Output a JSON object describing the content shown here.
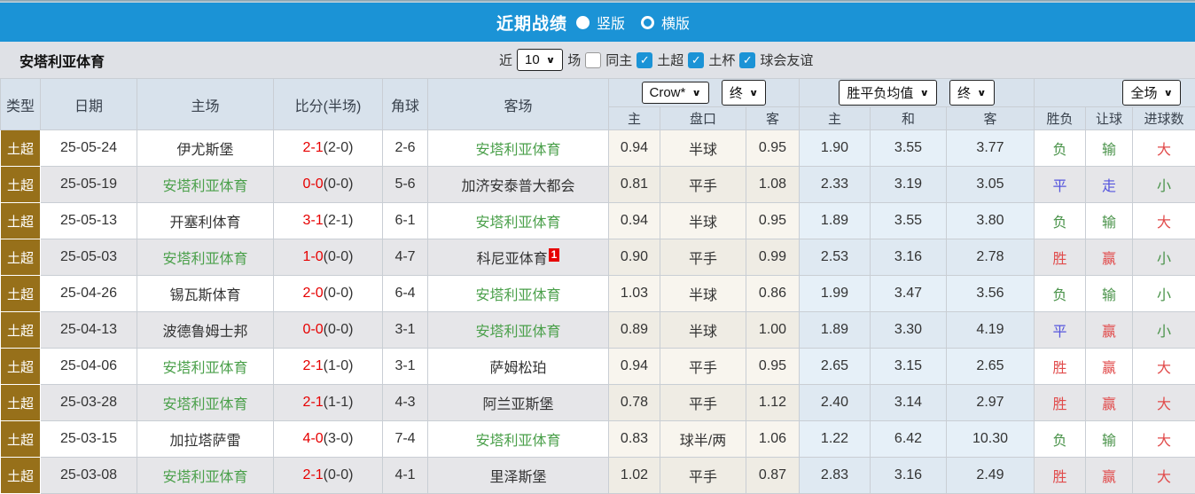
{
  "topbar": {
    "title": "近期战绩",
    "radio_vertical": "竖版",
    "radio_horizontal": "横版",
    "selected": "竖版"
  },
  "filterbar": {
    "team_name": "安塔利亚体育",
    "recent_label": "近",
    "recent_value": "10",
    "matches_label": "场",
    "checkboxes": [
      {
        "label": "同主",
        "checked": false
      },
      {
        "label": "土超",
        "checked": true
      },
      {
        "label": "土杯",
        "checked": true
      },
      {
        "label": "球会友谊",
        "checked": true
      }
    ]
  },
  "table": {
    "headers": {
      "type": "类型",
      "date": "日期",
      "home": "主场",
      "score": "比分(半场)",
      "corners": "角球",
      "away": "客场",
      "crow_select": "Crow*",
      "crow_final_select": "终",
      "avg_select": "胜平负均值",
      "avg_final_select": "终",
      "fulltime_select": "全场",
      "sub": [
        "主",
        "盘口",
        "客",
        "主",
        "和",
        "客",
        "胜负",
        "让球",
        "进球数"
      ]
    },
    "result_colors": {
      "胜": "red",
      "负": "green",
      "平": "blue",
      "赢": "red",
      "输": "green",
      "走": "blue",
      "大": "red",
      "小": "green"
    },
    "rows": [
      {
        "type": "土超",
        "date": "25-05-24",
        "home": "伊尤斯堡",
        "home_green": false,
        "score": "2-1",
        "half": "(2-0)",
        "corners": "2-6",
        "away": "安塔利亚体育",
        "away_green": true,
        "away_badge": "",
        "crow": [
          "0.94",
          "半球",
          "0.95"
        ],
        "avg": [
          "1.90",
          "3.55",
          "3.77"
        ],
        "results": [
          "负",
          "输",
          "大"
        ]
      },
      {
        "type": "土超",
        "date": "25-05-19",
        "home": "安塔利亚体育",
        "home_green": true,
        "score": "0-0",
        "half": "(0-0)",
        "corners": "5-6",
        "away": "加济安泰普大都会",
        "away_green": false,
        "away_badge": "",
        "crow": [
          "0.81",
          "平手",
          "1.08"
        ],
        "avg": [
          "2.33",
          "3.19",
          "3.05"
        ],
        "results": [
          "平",
          "走",
          "小"
        ]
      },
      {
        "type": "土超",
        "date": "25-05-13",
        "home": "开塞利体育",
        "home_green": false,
        "score": "3-1",
        "half": "(2-1)",
        "corners": "6-1",
        "away": "安塔利亚体育",
        "away_green": true,
        "away_badge": "",
        "crow": [
          "0.94",
          "半球",
          "0.95"
        ],
        "avg": [
          "1.89",
          "3.55",
          "3.80"
        ],
        "results": [
          "负",
          "输",
          "大"
        ]
      },
      {
        "type": "土超",
        "date": "25-05-03",
        "home": "安塔利亚体育",
        "home_green": true,
        "score": "1-0",
        "half": "(0-0)",
        "corners": "4-7",
        "away": "科尼亚体育",
        "away_green": false,
        "away_badge": "1",
        "crow": [
          "0.90",
          "平手",
          "0.99"
        ],
        "avg": [
          "2.53",
          "3.16",
          "2.78"
        ],
        "results": [
          "胜",
          "赢",
          "小"
        ]
      },
      {
        "type": "土超",
        "date": "25-04-26",
        "home": "锡瓦斯体育",
        "home_green": false,
        "score": "2-0",
        "half": "(0-0)",
        "corners": "6-4",
        "away": "安塔利亚体育",
        "away_green": true,
        "away_badge": "",
        "crow": [
          "1.03",
          "半球",
          "0.86"
        ],
        "avg": [
          "1.99",
          "3.47",
          "3.56"
        ],
        "results": [
          "负",
          "输",
          "小"
        ]
      },
      {
        "type": "土超",
        "date": "25-04-13",
        "home": "波德鲁姆士邦",
        "home_green": false,
        "score": "0-0",
        "half": "(0-0)",
        "corners": "3-1",
        "away": "安塔利亚体育",
        "away_green": true,
        "away_badge": "",
        "crow": [
          "0.89",
          "半球",
          "1.00"
        ],
        "avg": [
          "1.89",
          "3.30",
          "4.19"
        ],
        "results": [
          "平",
          "赢",
          "小"
        ]
      },
      {
        "type": "土超",
        "date": "25-04-06",
        "home": "安塔利亚体育",
        "home_green": true,
        "score": "2-1",
        "half": "(1-0)",
        "corners": "3-1",
        "away": "萨姆松珀",
        "away_green": false,
        "away_badge": "",
        "crow": [
          "0.94",
          "平手",
          "0.95"
        ],
        "avg": [
          "2.65",
          "3.15",
          "2.65"
        ],
        "results": [
          "胜",
          "赢",
          "大"
        ]
      },
      {
        "type": "土超",
        "date": "25-03-28",
        "home": "安塔利亚体育",
        "home_green": true,
        "score": "2-1",
        "half": "(1-1)",
        "corners": "4-3",
        "away": "阿兰亚斯堡",
        "away_green": false,
        "away_badge": "",
        "crow": [
          "0.78",
          "平手",
          "1.12"
        ],
        "avg": [
          "2.40",
          "3.14",
          "2.97"
        ],
        "results": [
          "胜",
          "赢",
          "大"
        ]
      },
      {
        "type": "土超",
        "date": "25-03-15",
        "home": "加拉塔萨雷",
        "home_green": false,
        "score": "4-0",
        "half": "(3-0)",
        "corners": "7-4",
        "away": "安塔利亚体育",
        "away_green": true,
        "away_badge": "",
        "crow": [
          "0.83",
          "球半/两",
          "1.06"
        ],
        "avg": [
          "1.22",
          "6.42",
          "10.30"
        ],
        "results": [
          "负",
          "输",
          "大"
        ]
      },
      {
        "type": "土超",
        "date": "25-03-08",
        "home": "安塔利亚体育",
        "home_green": true,
        "score": "2-1",
        "half": "(0-0)",
        "corners": "4-1",
        "away": "里泽斯堡",
        "away_green": false,
        "away_badge": "",
        "crow": [
          "1.02",
          "平手",
          "0.87"
        ],
        "avg": [
          "2.83",
          "3.16",
          "2.49"
        ],
        "results": [
          "胜",
          "赢",
          "大"
        ]
      }
    ]
  },
  "colors": {
    "accent_blue": "#1b93d6",
    "league_gold": "#97701a",
    "team_green": "#4ba04b",
    "score_red": "#e60000",
    "result_red": "#e14b4b",
    "result_green": "#4a934a",
    "result_blue": "#5555dd"
  }
}
